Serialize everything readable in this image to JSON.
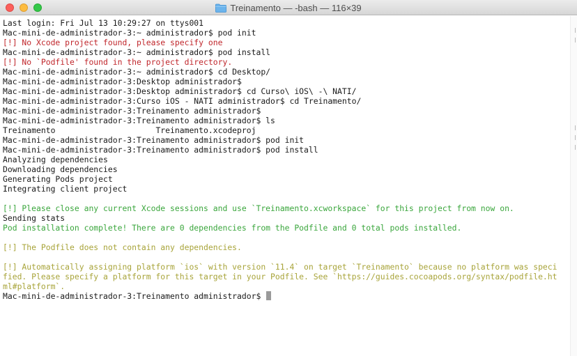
{
  "window": {
    "title": "Treinamento — -bash — 116×39",
    "folder_icon": "folder-icon",
    "close_icon": "close-button-icon",
    "minimize_icon": "minimize-button-icon",
    "zoom_icon": "zoom-button-icon"
  },
  "colors": {
    "error": "#c0262b",
    "success": "#3aa63c",
    "warning": "#a8a43a",
    "text": "#1a1a1a"
  },
  "terminal": {
    "lines": [
      {
        "text": "Last login: Fri Jul 13 10:29:27 on ttys001",
        "style": "normal"
      },
      {
        "text": "Mac-mini-de-administrador-3:~ administrador$ pod init",
        "style": "normal"
      },
      {
        "text": "[!] No Xcode project found, please specify one",
        "style": "red"
      },
      {
        "text": "Mac-mini-de-administrador-3:~ administrador$ pod install",
        "style": "normal"
      },
      {
        "text": "[!] No `Podfile' found in the project directory.",
        "style": "red"
      },
      {
        "text": "Mac-mini-de-administrador-3:~ administrador$ cd Desktop/",
        "style": "normal"
      },
      {
        "text": "Mac-mini-de-administrador-3:Desktop administrador$",
        "style": "normal"
      },
      {
        "text": "Mac-mini-de-administrador-3:Desktop administrador$ cd Curso\\ iOS\\ -\\ NATI/",
        "style": "normal"
      },
      {
        "text": "Mac-mini-de-administrador-3:Curso iOS - NATI administrador$ cd Treinamento/",
        "style": "normal"
      },
      {
        "text": "Mac-mini-de-administrador-3:Treinamento administrador$",
        "style": "normal"
      },
      {
        "text": "Mac-mini-de-administrador-3:Treinamento administrador$ ls",
        "style": "normal"
      },
      {
        "text": "Treinamento\t\t\tTreinamento.xcodeproj",
        "style": "normal"
      },
      {
        "text": "Mac-mini-de-administrador-3:Treinamento administrador$ pod init",
        "style": "normal"
      },
      {
        "text": "Mac-mini-de-administrador-3:Treinamento administrador$ pod install",
        "style": "normal"
      },
      {
        "text": "Analyzing dependencies",
        "style": "normal"
      },
      {
        "text": "Downloading dependencies",
        "style": "normal"
      },
      {
        "text": "Generating Pods project",
        "style": "normal"
      },
      {
        "text": "Integrating client project",
        "style": "normal"
      },
      {
        "text": "",
        "style": "normal"
      },
      {
        "text": "[!] Please close any current Xcode sessions and use `Treinamento.xcworkspace` for this project from now on.",
        "style": "green"
      },
      {
        "text": "Sending stats",
        "style": "normal"
      },
      {
        "text": "Pod installation complete! There are 0 dependencies from the Podfile and 0 total pods installed.",
        "style": "green"
      },
      {
        "text": "",
        "style": "normal"
      },
      {
        "text": "[!] The Podfile does not contain any dependencies.",
        "style": "yellow"
      },
      {
        "text": "",
        "style": "normal"
      },
      {
        "text": "[!] Automatically assigning platform `ios` with version `11.4` on target `Treinamento` because no platform was speci",
        "style": "yellow"
      },
      {
        "text": "fied. Please specify a platform for this target in your Podfile. See `https://guides.cocoapods.org/syntax/podfile.ht",
        "style": "yellow"
      },
      {
        "text": "ml#platform`.",
        "style": "yellow"
      }
    ],
    "prompt": "Mac-mini-de-administrador-3:Treinamento administrador$ "
  }
}
